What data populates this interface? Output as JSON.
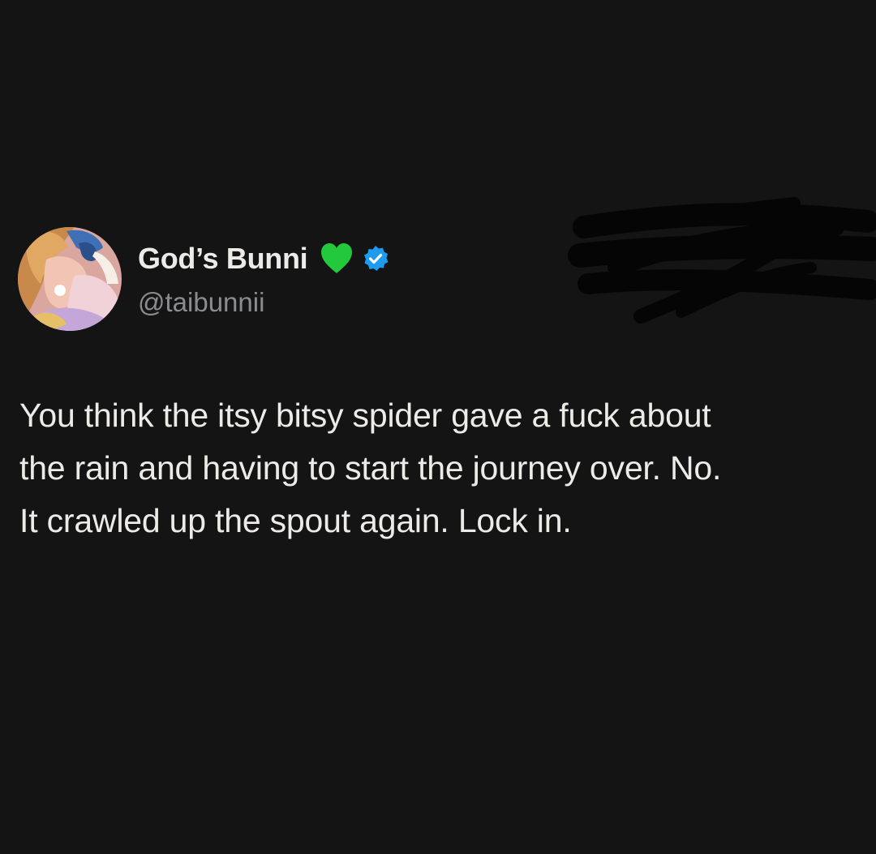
{
  "author": {
    "display_name": "God’s Bunni",
    "handle": "@taibunnii",
    "name_emoji": "green-heart-icon",
    "verified_icon": "verified-badge-icon",
    "verified_color": "#1d9bf0",
    "heart_color": "#21c93b"
  },
  "tweet": {
    "lines": [
      "You think the itsy bitsy spider gave a fuck about",
      "the rain and having to start the journey over. No.",
      "It crawled up the spout again. Lock in."
    ]
  },
  "theme": {
    "background": "#141414",
    "text": "#ecebe7",
    "muted": "#8a8c90"
  }
}
